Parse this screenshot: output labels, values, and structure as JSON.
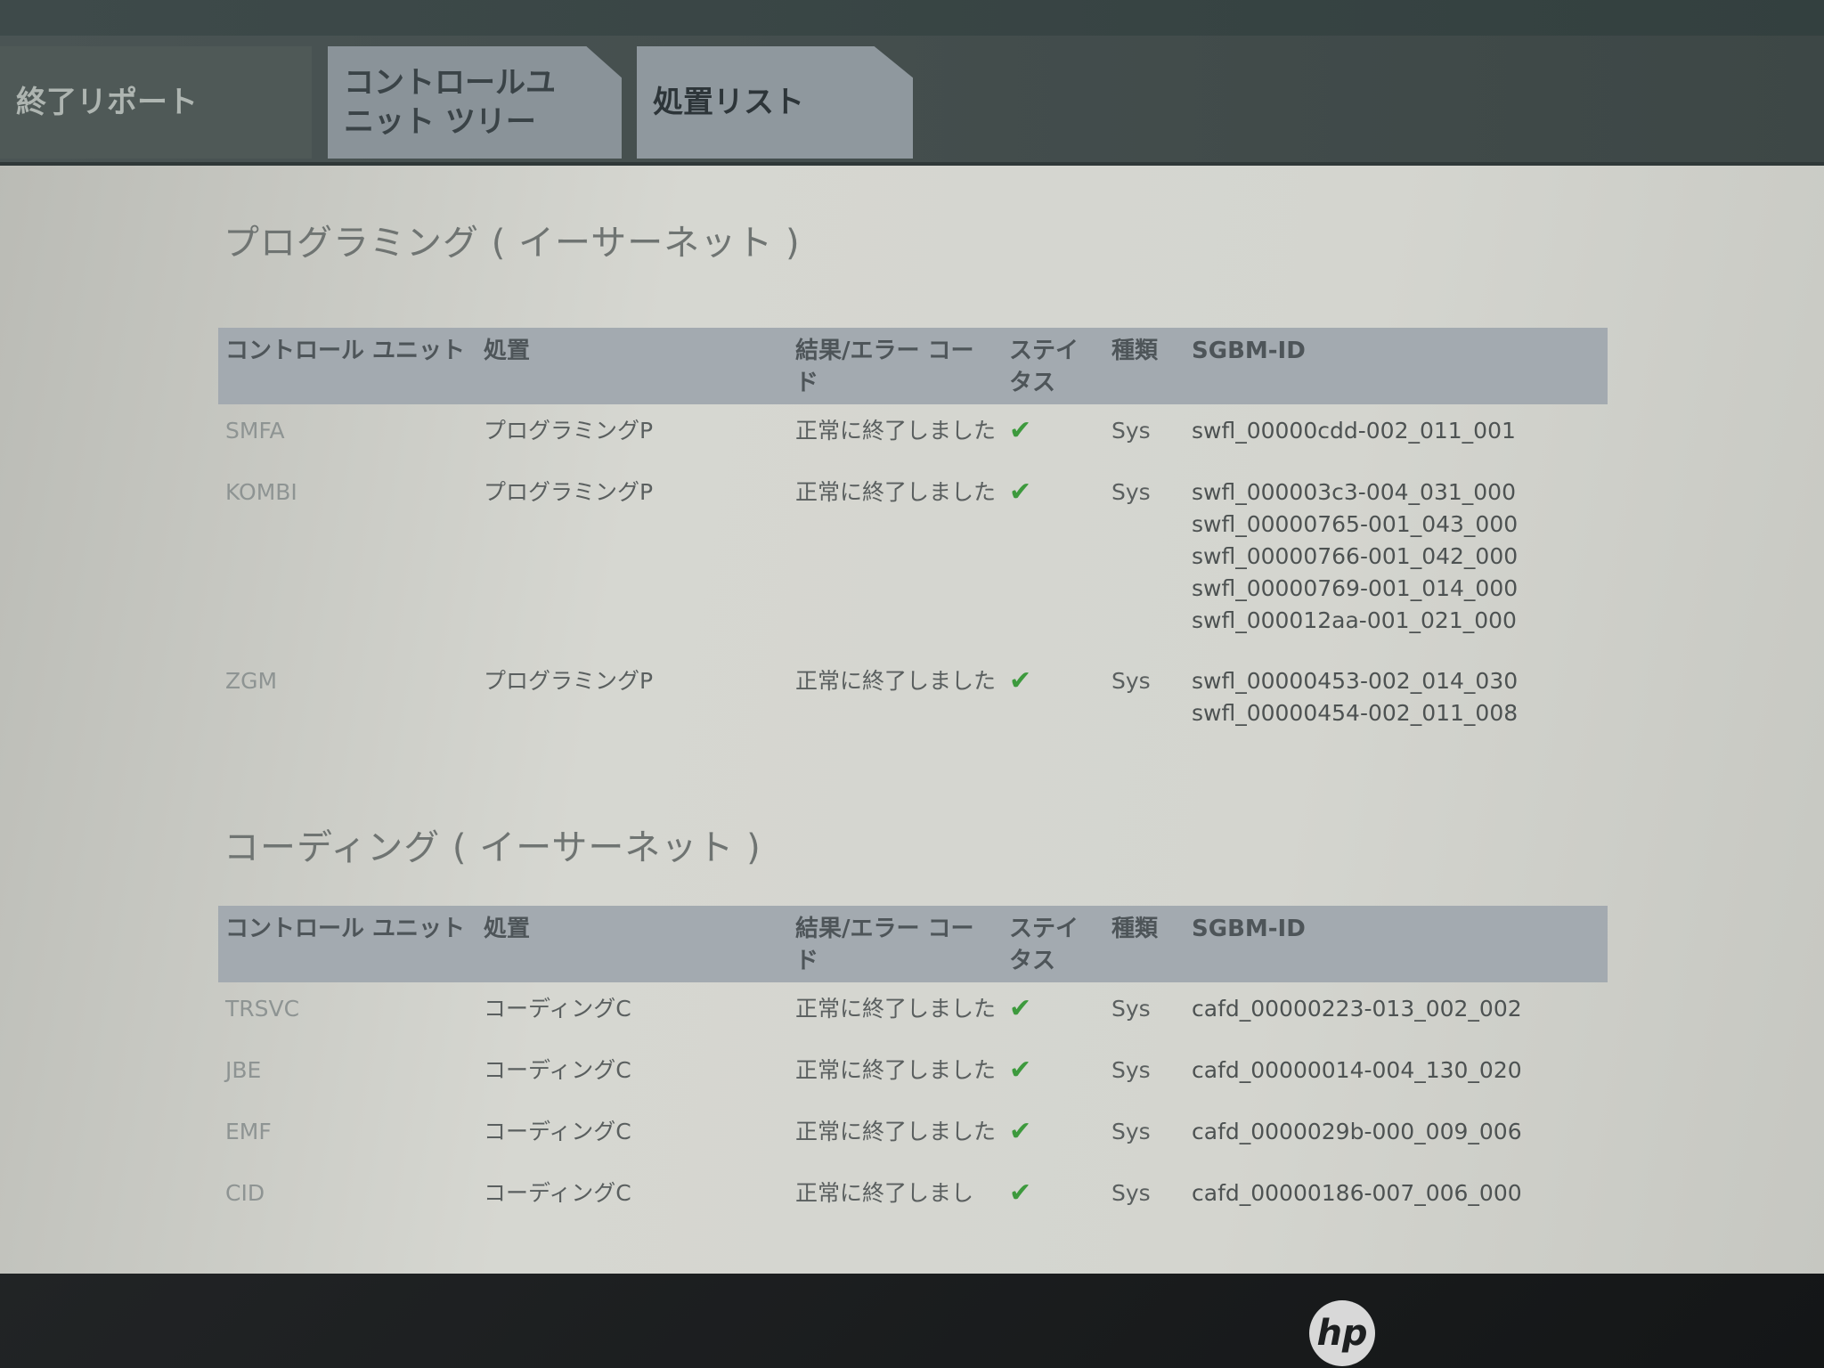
{
  "tabs": [
    {
      "label": "終了リポート"
    },
    {
      "label": "コントロールユニット ツリー"
    },
    {
      "label": "処置リスト"
    }
  ],
  "programming": {
    "title": "プログラミング ( イーサーネット )",
    "headers": {
      "unit": "コントロール ユニット",
      "action": "処置",
      "result": "結果/エラー コード",
      "status": "ステイタス",
      "type": "種類",
      "sgbm": "SGBM-ID"
    },
    "rows": [
      {
        "unit": "SMFA",
        "action": "プログラミングP",
        "result": "正常に終了しました",
        "type": "Sys",
        "sgbm": [
          "swfl_00000cdd-002_011_001"
        ]
      },
      {
        "unit": "KOMBI",
        "action": "プログラミングP",
        "result": "正常に終了しました",
        "type": "Sys",
        "sgbm": [
          "swfl_000003c3-004_031_000",
          "swfl_00000765-001_043_000",
          "swfl_00000766-001_042_000",
          "swfl_00000769-001_014_000",
          "swfl_000012aa-001_021_000"
        ]
      },
      {
        "unit": "ZGM",
        "action": "プログラミングP",
        "result": "正常に終了しました",
        "type": "Sys",
        "sgbm": [
          "swfl_00000453-002_014_030",
          "swfl_00000454-002_011_008"
        ]
      }
    ]
  },
  "coding": {
    "title": "コーディング ( イーサーネット )",
    "headers": {
      "unit": "コントロール ユニット",
      "action": "処置",
      "result": "結果/エラー コード",
      "status": "ステイタス",
      "type": "種類",
      "sgbm": "SGBM-ID"
    },
    "rows": [
      {
        "unit": "TRSVC",
        "action": "コーディングC",
        "result": "正常に終了しました",
        "type": "Sys",
        "sgbm": [
          "cafd_00000223-013_002_002"
        ]
      },
      {
        "unit": "JBE",
        "action": "コーディングC",
        "result": "正常に終了しました",
        "type": "Sys",
        "sgbm": [
          "cafd_00000014-004_130_020"
        ]
      },
      {
        "unit": "EMF",
        "action": "コーディングC",
        "result": "正常に終了しました",
        "type": "Sys",
        "sgbm": [
          "cafd_0000029b-000_009_006"
        ]
      },
      {
        "unit": "CID",
        "action": "コーディングC",
        "result": "正常に終了しまし",
        "type": "Sys",
        "sgbm": [
          "cafd_00000186-007_006_000"
        ]
      }
    ]
  },
  "status_icon": "check-icon",
  "colors": {
    "check": "#3d9a3d",
    "header_bg": "#a3aab0",
    "tabbar_bg": "#4a5454"
  },
  "bezel": {
    "logo": "hp"
  }
}
